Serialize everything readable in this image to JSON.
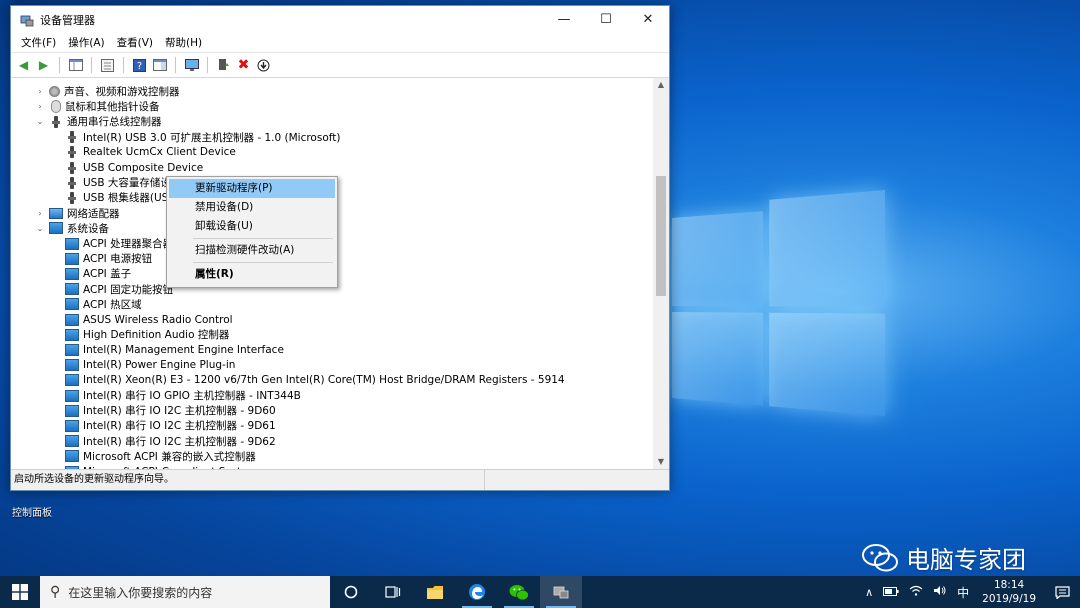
{
  "window": {
    "title": "设备管理器",
    "menu": [
      "文件(F)",
      "操作(A)",
      "查看(V)",
      "帮助(H)"
    ],
    "status_text": "启动所选设备的更新驱动程序向导。"
  },
  "tree": [
    {
      "label": "声音、视频和游戏控制器",
      "level": 0,
      "expander": "›",
      "icon": "sound"
    },
    {
      "label": "鼠标和其他指针设备",
      "level": 0,
      "expander": "›",
      "icon": "mouse"
    },
    {
      "label": "通用串行总线控制器",
      "level": 0,
      "expander": "⌄",
      "icon": "usb"
    },
    {
      "label": "Intel(R) USB 3.0 可扩展主机控制器 - 1.0 (Microsoft)",
      "level": 1,
      "icon": "usb"
    },
    {
      "label": "Realtek UcmCx Client Device",
      "level": 1,
      "icon": "usb"
    },
    {
      "label": "USB Composite Device",
      "level": 1,
      "icon": "usb"
    },
    {
      "label": "USB 大容量存储设备",
      "level": 1,
      "icon": "usb"
    },
    {
      "label": "USB 根集线器(USB 3.0)",
      "level": 1,
      "icon": "usb"
    },
    {
      "label": "网络适配器",
      "level": 0,
      "expander": "›",
      "icon": "net"
    },
    {
      "label": "系统设备",
      "level": 0,
      "expander": "⌄",
      "icon": "sys"
    },
    {
      "label": "ACPI 处理器聚合器",
      "level": 1,
      "icon": "sys"
    },
    {
      "label": "ACPI 电源按钮",
      "level": 1,
      "icon": "sys"
    },
    {
      "label": "ACPI 盖子",
      "level": 1,
      "icon": "sys"
    },
    {
      "label": "ACPI 固定功能按钮",
      "level": 1,
      "icon": "sys"
    },
    {
      "label": "ACPI 热区域",
      "level": 1,
      "icon": "sys"
    },
    {
      "label": "ASUS Wireless Radio Control",
      "level": 1,
      "icon": "sys"
    },
    {
      "label": "High Definition Audio 控制器",
      "level": 1,
      "icon": "sys"
    },
    {
      "label": "Intel(R) Management Engine Interface",
      "level": 1,
      "icon": "sys"
    },
    {
      "label": "Intel(R) Power Engine Plug-in",
      "level": 1,
      "icon": "sys"
    },
    {
      "label": "Intel(R) Xeon(R) E3 - 1200 v6/7th Gen Intel(R) Core(TM) Host Bridge/DRAM Registers - 5914",
      "level": 1,
      "icon": "sys"
    },
    {
      "label": "Intel(R) 串行 IO GPIO 主机控制器 - INT344B",
      "level": 1,
      "icon": "sys"
    },
    {
      "label": "Intel(R) 串行 IO I2C 主机控制器 - 9D60",
      "level": 1,
      "icon": "sys"
    },
    {
      "label": "Intel(R) 串行 IO I2C 主机控制器 - 9D61",
      "level": 1,
      "icon": "sys"
    },
    {
      "label": "Intel(R) 串行 IO I2C 主机控制器 - 9D62",
      "level": 1,
      "icon": "sys"
    },
    {
      "label": "Microsoft ACPI 兼容的嵌入式控制器",
      "level": 1,
      "icon": "sys"
    },
    {
      "label": "Microsoft ACPI-Compliant System",
      "level": 1,
      "icon": "sys"
    }
  ],
  "context_menu": {
    "update_driver": "更新驱动程序(P)",
    "disable": "禁用设备(D)",
    "uninstall": "卸载设备(U)",
    "scan": "扫描检测硬件改动(A)",
    "properties": "属性(R)"
  },
  "desktop": {
    "icon_label": "控制面板",
    "watermark": "电脑专家团"
  },
  "taskbar": {
    "search_placeholder": "在这里输入你要搜索的内容",
    "ime": "中",
    "time": "18:14",
    "date": "2019/9/19"
  },
  "colors": {
    "menu_highlight": "#91c9f7",
    "taskbar": "#0b2a4a",
    "desktop_blue": "#0a63cc"
  }
}
